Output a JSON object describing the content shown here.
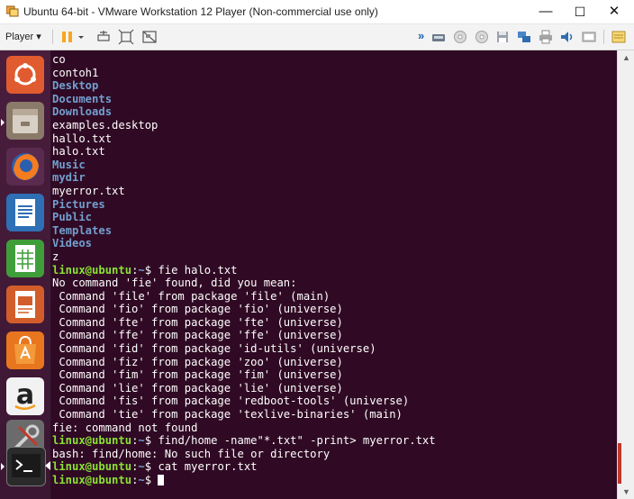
{
  "window": {
    "title": "Ubuntu 64-bit - VMware Workstation 12 Player (Non-commercial use only)",
    "minimize_glyph": "—",
    "maximize_glyph": "☐",
    "close_glyph": "✕"
  },
  "toolbar": {
    "player_label": "Player",
    "player_arrow": "▾",
    "more_glyph": "»",
    "icons": [
      "pause-icon",
      "send-ctrl-alt-del-icon",
      "fit-guest-icon",
      "unity-mode-icon",
      "usb-device-icon",
      "cd-drive-icon",
      "floppy-icon",
      "network-adapter-icon",
      "printer-icon",
      "sound-icon",
      "display-icon",
      "message-log-icon"
    ]
  },
  "launcher": {
    "items": [
      "ubuntu-dash",
      "files",
      "firefox",
      "libreoffice-writer",
      "libreoffice-calc",
      "libreoffice-impress",
      "ubuntu-software",
      "amazon",
      "system-settings",
      "terminal"
    ],
    "amazon_letter": "a"
  },
  "terminal": {
    "user_host": "linux@ubuntu",
    "path": "~",
    "lines": [
      {
        "type": "file",
        "text": "co"
      },
      {
        "type": "file",
        "text": "contoh1"
      },
      {
        "type": "dir",
        "text": "Desktop"
      },
      {
        "type": "dir",
        "text": "Documents"
      },
      {
        "type": "dir",
        "text": "Downloads"
      },
      {
        "type": "file",
        "text": "examples.desktop"
      },
      {
        "type": "file",
        "text": "hallo.txt"
      },
      {
        "type": "file",
        "text": "halo.txt"
      },
      {
        "type": "dir",
        "text": "Music"
      },
      {
        "type": "dir",
        "text": "mydir"
      },
      {
        "type": "file",
        "text": "myerror.txt"
      },
      {
        "type": "dir",
        "text": "Pictures"
      },
      {
        "type": "dir",
        "text": "Public"
      },
      {
        "type": "dir",
        "text": "Templates"
      },
      {
        "type": "dir",
        "text": "Videos"
      },
      {
        "type": "file",
        "text": "z"
      },
      {
        "type": "prompt",
        "text": "fie halo.txt"
      },
      {
        "type": "output",
        "text": "No command 'fie' found, did you mean:"
      },
      {
        "type": "output",
        "text": " Command 'file' from package 'file' (main)"
      },
      {
        "type": "output",
        "text": " Command 'fio' from package 'fio' (universe)"
      },
      {
        "type": "output",
        "text": " Command 'fte' from package 'fte' (universe)"
      },
      {
        "type": "output",
        "text": " Command 'ffe' from package 'ffe' (universe)"
      },
      {
        "type": "output",
        "text": " Command 'fid' from package 'id-utils' (universe)"
      },
      {
        "type": "output",
        "text": " Command 'fiz' from package 'zoo' (universe)"
      },
      {
        "type": "output",
        "text": " Command 'fim' from package 'fim' (universe)"
      },
      {
        "type": "output",
        "text": " Command 'lie' from package 'lie' (universe)"
      },
      {
        "type": "output",
        "text": " Command 'fis' from package 'redboot-tools' (universe)"
      },
      {
        "type": "output",
        "text": " Command 'tie' from package 'texlive-binaries' (main)"
      },
      {
        "type": "output",
        "text": "fie: command not found"
      },
      {
        "type": "prompt",
        "text": "find/home -name\"*.txt\" -print> myerror.txt"
      },
      {
        "type": "output",
        "text": "bash: find/home: No such file or directory"
      },
      {
        "type": "prompt",
        "text": "cat myerror.txt"
      },
      {
        "type": "prompt",
        "text": ""
      }
    ]
  },
  "scrollbar": {
    "up_glyph": "▲",
    "down_glyph": "▼"
  },
  "colors": {
    "terminal_bg": "#300a24",
    "prompt": "#8ae234",
    "directory": "#729fcf",
    "launcher_bg": "#4a1d3d"
  }
}
